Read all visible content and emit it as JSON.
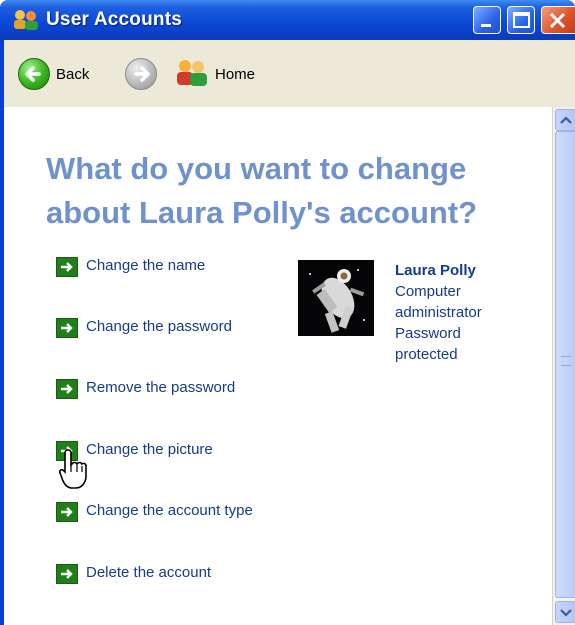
{
  "window": {
    "title": "User Accounts",
    "accent_color": "#0a3ed6"
  },
  "toolbar": {
    "back_label": "Back",
    "home_label": "Home"
  },
  "main": {
    "heading_line1": "What do you want to change",
    "heading_line2": "about Laura Polly's account?",
    "tasks": [
      {
        "label": "Change the name"
      },
      {
        "label": "Change the password"
      },
      {
        "label": "Remove the password"
      },
      {
        "label": "Change the picture"
      },
      {
        "label": "Change the account type"
      },
      {
        "label": "Delete the account"
      }
    ],
    "account": {
      "name": "Laura Polly",
      "type_line1": "Computer",
      "type_line2": "administrator",
      "status_line1": "Password",
      "status_line2": "protected",
      "picture_icon": "astronaut-picture"
    }
  }
}
